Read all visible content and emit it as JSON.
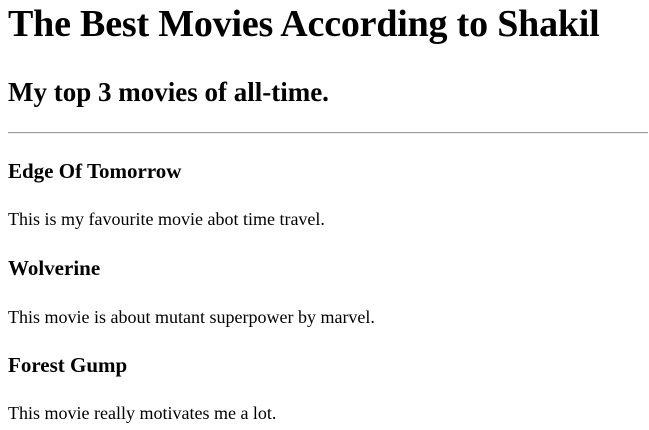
{
  "page": {
    "title": "The Best Movies According to Shakil",
    "subtitle": "My top 3 movies of all-time."
  },
  "movies": [
    {
      "title": "Edge Of Tomorrow",
      "description": "This is my favourite movie abot time travel."
    },
    {
      "title": "Wolverine",
      "description": "This movie is about mutant superpower by marvel."
    },
    {
      "title": "Forest Gump",
      "description": "This movie really motivates me a lot."
    }
  ]
}
